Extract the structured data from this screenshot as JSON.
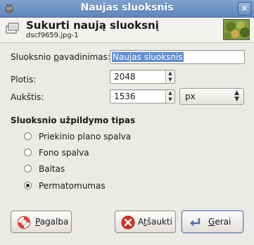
{
  "window": {
    "title": "Naujas sluoksnis",
    "close_symbol": "✕"
  },
  "header": {
    "title": "Sukurti naują sluoksnį",
    "subtitle": "dscf9659.jpg-1"
  },
  "form": {
    "name_label_pre": "Sluoksnio ",
    "name_label_mnemonic": "p",
    "name_label_post": "avadinimas:",
    "name_value": "Naujas sluoksnis",
    "width_label": "Plotis:",
    "width_value": "2048",
    "height_label": "Aukštis:",
    "height_value": "1536",
    "unit_value": "px"
  },
  "fill": {
    "section_title": "Sluoksnio užpildymo tipas",
    "options": [
      {
        "label": "Priekinio plano spalva",
        "selected": false
      },
      {
        "label": "Fono spalva",
        "selected": false
      },
      {
        "label": "Baltas",
        "selected": false
      },
      {
        "label": "Permatomumas",
        "selected": true
      }
    ]
  },
  "buttons": {
    "help": {
      "mnemonic": "P",
      "rest": "agalba"
    },
    "cancel": {
      "pre": "A",
      "mnemonic": "t",
      "rest": "šaukti"
    },
    "ok": {
      "mnemonic": "G",
      "rest": "erai"
    }
  },
  "colors": {
    "titlebar": "#6f94c8",
    "selection": "#5f8dd3",
    "cancel_red": "#d9302c",
    "help_red": "#e0403a"
  }
}
